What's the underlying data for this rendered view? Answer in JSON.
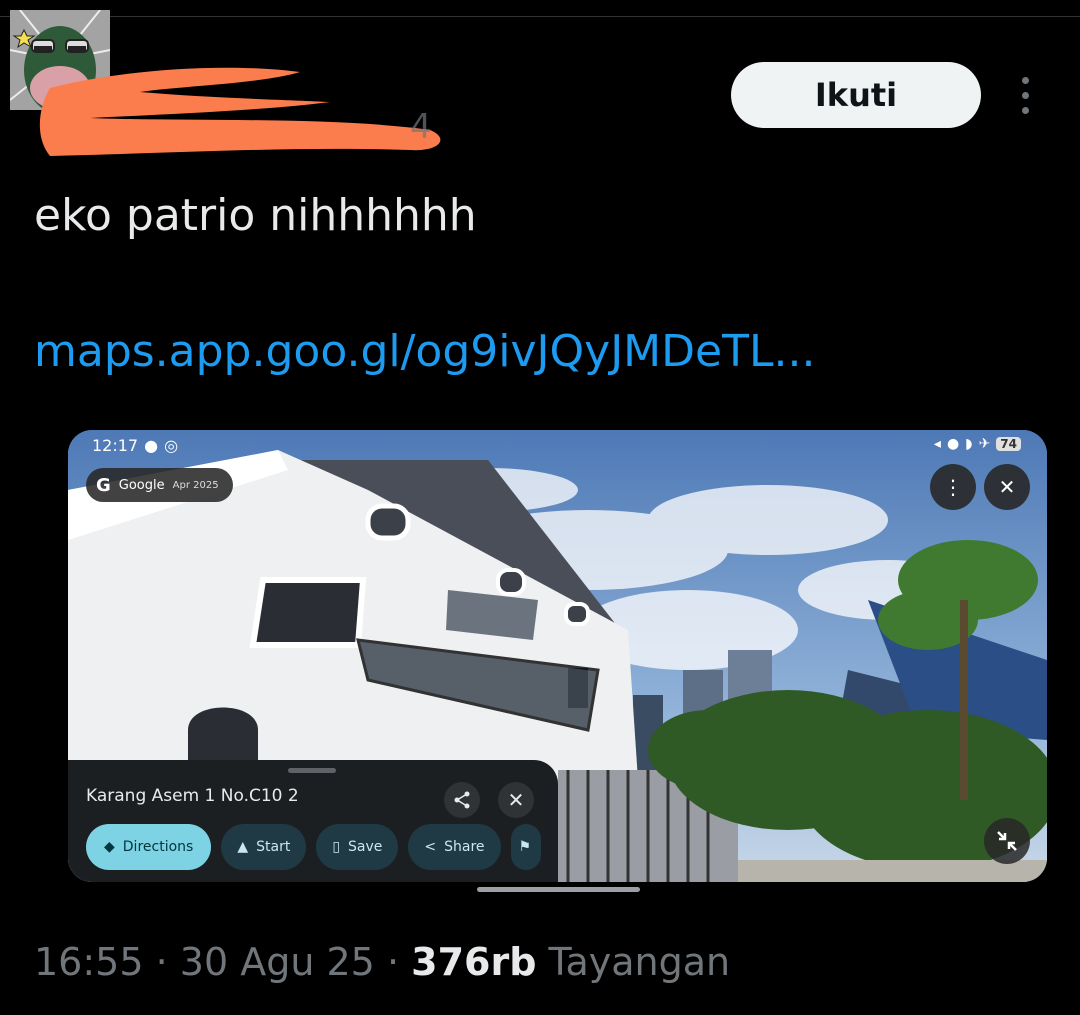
{
  "header": {
    "follow_label": "Ikuti",
    "more_icon": "more-vertical-icon"
  },
  "tweet": {
    "text": "eko patrio nihhhhhh",
    "link": "maps.app.goo.gl/og9ivJQyJMDeTL..."
  },
  "media": {
    "status_time": "12:17",
    "status_battery": "74",
    "google_brand": "Google",
    "google_date": "Apr 2025",
    "place_title": "Karang Asem 1 No.C10 2",
    "actions": [
      "Directions",
      "Start",
      "Save",
      "Share"
    ]
  },
  "meta": {
    "time": "16:55",
    "date": "30 Agu 25",
    "views_count": "376rb",
    "views_label": "Tayangan",
    "separator": "·"
  },
  "colors": {
    "background": "#000000",
    "link": "#1d9bf0",
    "follow_bg": "#eff3f4",
    "redaction": "#ff7f50",
    "directions_bg": "#7dd3e3"
  }
}
